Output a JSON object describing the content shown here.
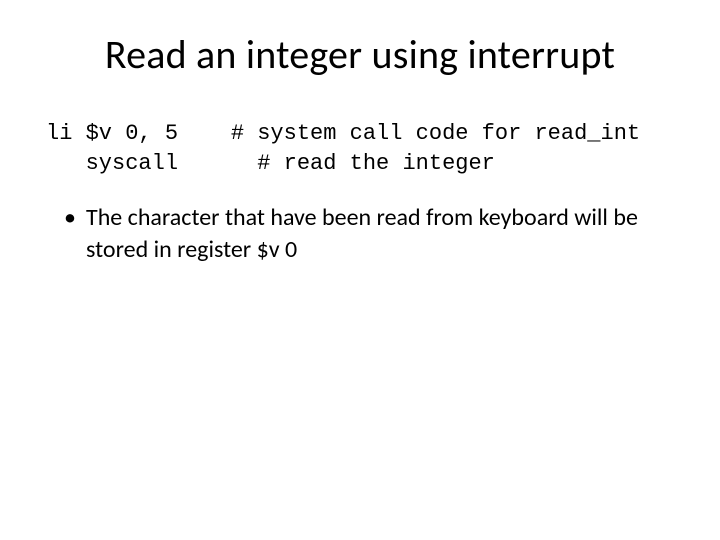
{
  "slide": {
    "title": "Read an integer using interrupt",
    "code": {
      "line1": "li $v 0, 5    # system call code for read_int",
      "line2": "   syscall      # read the integer"
    },
    "bullets": [
      "The character that have been read from keyboard will be stored in register $v 0"
    ]
  }
}
